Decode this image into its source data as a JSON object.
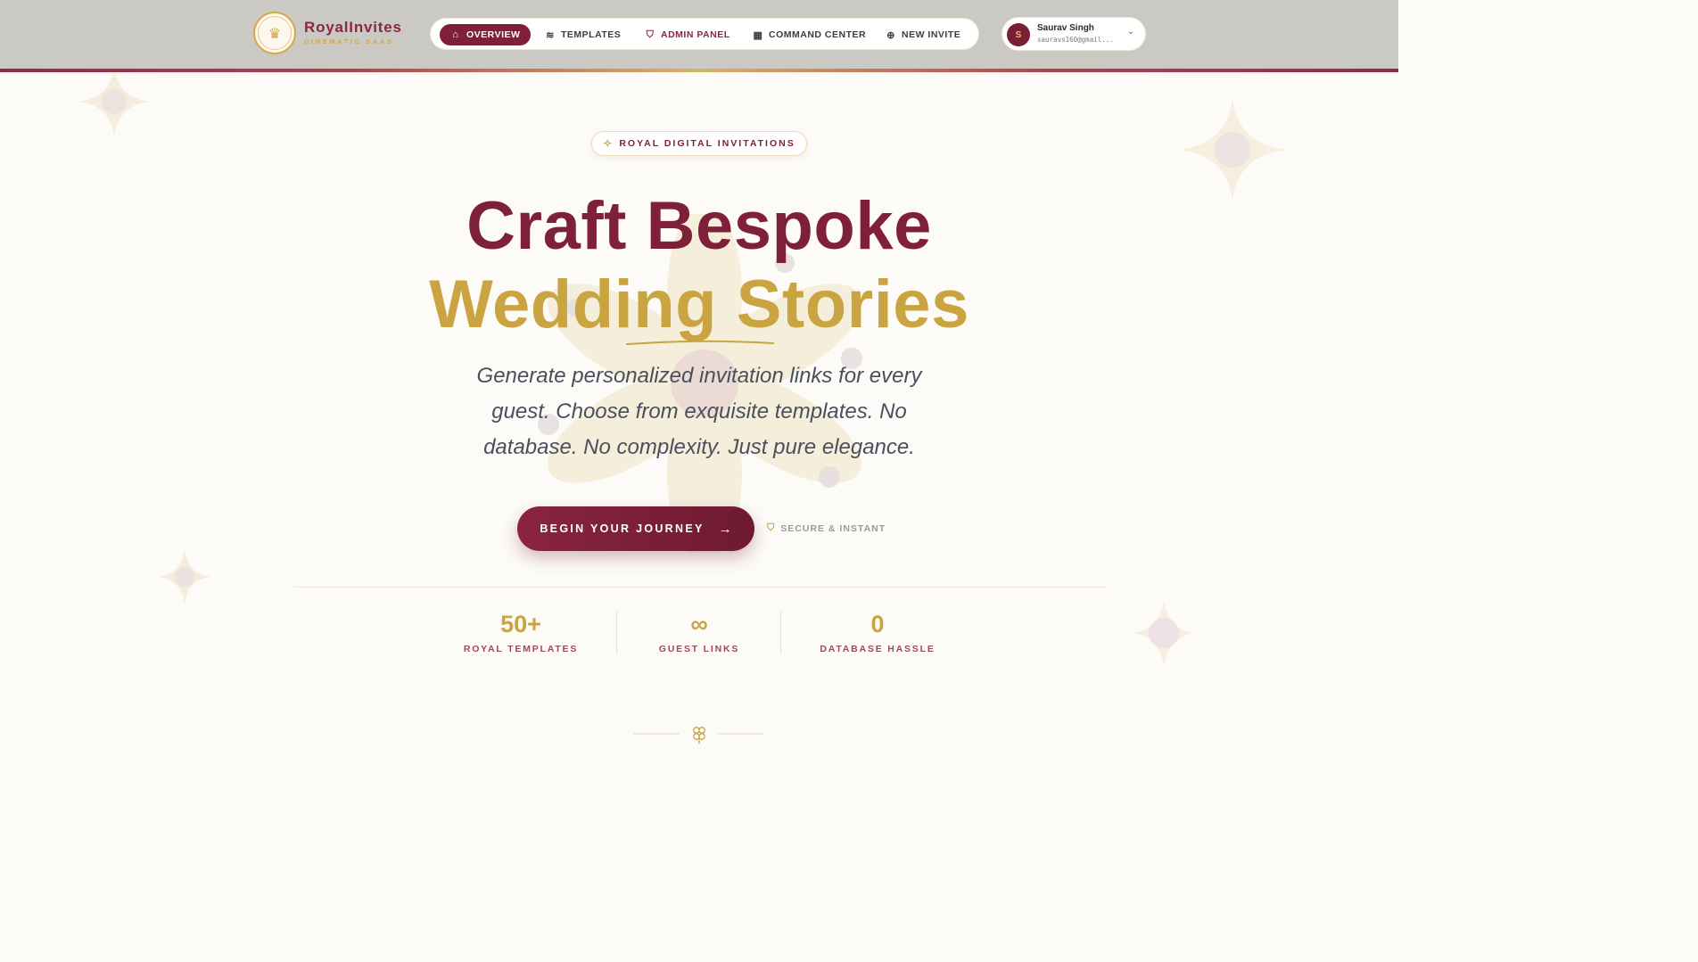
{
  "header": {
    "brand_name": "RoyalInvites",
    "brand_tagline": "CINEMATIC SAAS",
    "nav": [
      {
        "label": "OVERVIEW",
        "icon": "home-icon",
        "active": true
      },
      {
        "label": "TEMPLATES",
        "icon": "layers-icon",
        "active": false
      },
      {
        "label": "ADMIN PANEL",
        "icon": "shield-icon",
        "active": false
      },
      {
        "label": "COMMAND CENTER",
        "icon": "grid-icon",
        "active": false
      },
      {
        "label": "NEW INVITE",
        "icon": "plus-circle-icon",
        "active": false
      }
    ],
    "user": {
      "initial": "S",
      "name": "Saurav Singh",
      "email": "sauravs160@gmail..."
    }
  },
  "hero": {
    "tag": "ROYAL DIGITAL INVITATIONS",
    "title_line1": "Craft Bespoke",
    "title_line2": "Wedding Stories",
    "subtitle": "Generate personalized invitation links for every guest. Choose from exquisite templates. No database. No complexity. Just pure elegance.",
    "cta_label": "BEGIN YOUR JOURNEY",
    "secure_label": "SECURE & INSTANT"
  },
  "stats": [
    {
      "value": "50+",
      "label": "ROYAL TEMPLATES"
    },
    {
      "value": "∞",
      "label": "GUEST LINKS"
    },
    {
      "value": "0",
      "label": "DATABASE HASSLE"
    }
  ],
  "colors": {
    "primary": "#7e2038",
    "gold": "#c9a440",
    "background": "#fcfbf8",
    "header_bg": "#cbc9c4"
  }
}
